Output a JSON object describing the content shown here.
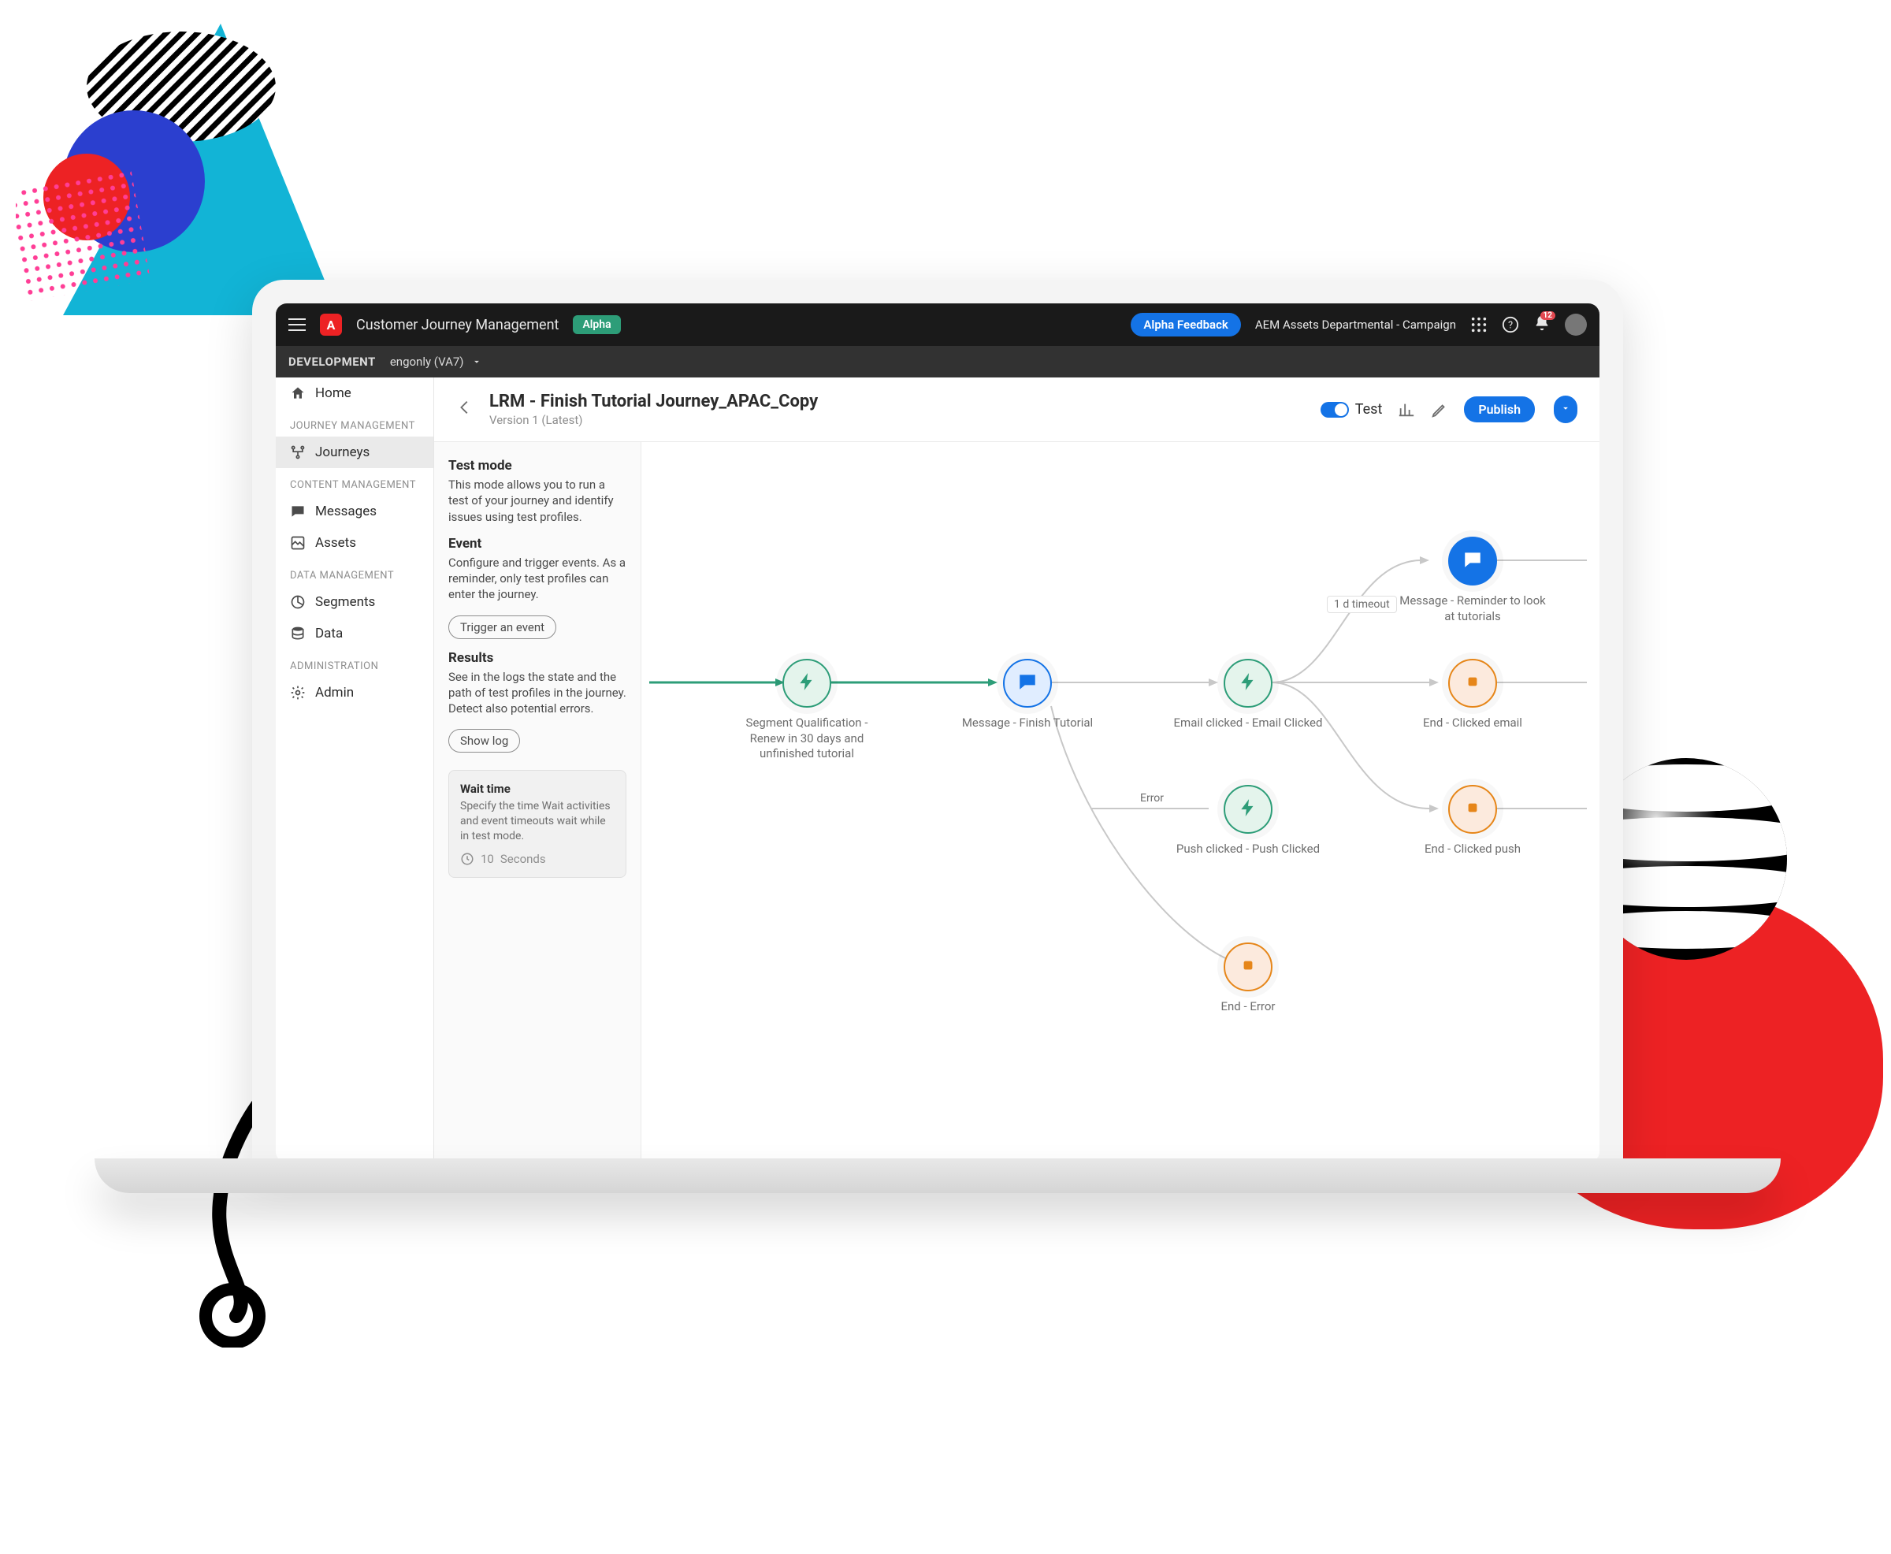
{
  "topbar": {
    "app_title": "Customer Journey Management",
    "alpha_badge": "Alpha",
    "feedback_button": "Alpha Feedback",
    "org_name": "AEM Assets Departmental - Campaign",
    "notification_count": "12"
  },
  "devbar": {
    "label": "DEVELOPMENT",
    "sandbox": "engonly (VA7)"
  },
  "leftnav": {
    "home": "Home",
    "sections": {
      "journey_management": "JOURNEY MANAGEMENT",
      "content_management": "CONTENT MANAGEMENT",
      "data_management": "DATA MANAGEMENT",
      "administration": "ADMINISTRATION"
    },
    "items": {
      "journeys": "Journeys",
      "messages": "Messages",
      "assets": "Assets",
      "segments": "Segments",
      "data": "Data",
      "admin": "Admin"
    }
  },
  "header": {
    "title": "LRM - Finish Tutorial Journey_APAC_Copy",
    "version": "Version 1 (Latest)",
    "toggle_label": "Test",
    "publish_button": "Publish"
  },
  "test_panel": {
    "title": "Test mode",
    "desc": "This mode allows you to run a test of your journey and identify issues using test profiles.",
    "event_title": "Event",
    "event_desc": "Configure and trigger events. As a reminder, only test profiles can enter the journey.",
    "trigger_button": "Trigger an event",
    "results_title": "Results",
    "results_desc": "See in the logs the state and the path of test profiles in the journey. Detect also potential errors.",
    "show_log_button": "Show log",
    "wait_title": "Wait time",
    "wait_desc": "Specify the time Wait activities and event timeouts wait while in test mode.",
    "wait_value": "10",
    "wait_unit": "Seconds"
  },
  "canvas": {
    "timeout_label": "1 d timeout",
    "error_label": "Error",
    "nodes": {
      "segment": "Segment Qualification - Renew in 30 days and unfinished tutorial",
      "msg_finish": "Message - Finish Tutorial",
      "email_clicked": "Email clicked - Email Clicked",
      "push_clicked": "Push clicked - Push Clicked",
      "msg_reminder": "Message - Reminder to look at tutorials",
      "end_email": "End - Clicked email",
      "end_push": "End - Clicked push",
      "end_error": "End - Error"
    }
  }
}
